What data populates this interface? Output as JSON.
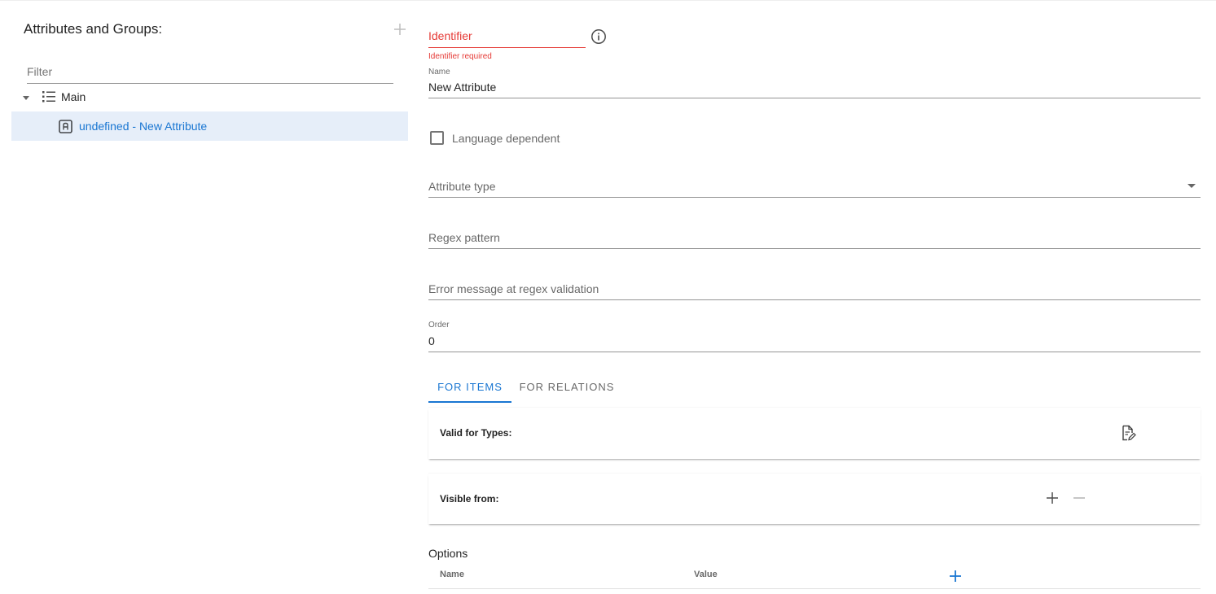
{
  "left_panel": {
    "title": "Attributes and Groups:",
    "filter_placeholder": "Filter",
    "tree": {
      "group_label": "Main",
      "child_label": "undefined - New Attribute"
    }
  },
  "form": {
    "identifier": {
      "label": "Identifier",
      "error": "Identifier required"
    },
    "name": {
      "label": "Name",
      "value": "New Attribute"
    },
    "language_dependent": {
      "label": "Language dependent",
      "checked": false
    },
    "attribute_type": {
      "placeholder": "Attribute type"
    },
    "regex_pattern": {
      "placeholder": "Regex pattern"
    },
    "regex_error": {
      "placeholder": "Error message at regex validation"
    },
    "order": {
      "label": "Order",
      "value": "0"
    }
  },
  "tabs": [
    {
      "label": "FOR ITEMS",
      "active": true
    },
    {
      "label": "FOR RELATIONS",
      "active": false
    }
  ],
  "cards": {
    "valid_for_types": "Valid for Types:",
    "visible_from": "Visible from:"
  },
  "options": {
    "title": "Options",
    "columns": [
      "Name",
      "Value"
    ]
  },
  "colors": {
    "accent": "#1976d2",
    "error": "#e53935",
    "selected_row": "#e6eef9"
  },
  "icons": {
    "add_group": "plus-icon",
    "caret": "caret-down-icon",
    "group": "list-icon",
    "attribute": "attribute-a-icon",
    "info": "info-icon",
    "edit_types": "edit-document-icon",
    "add_visible": "plus-icon",
    "remove_visible": "minus-icon",
    "add_option": "plus-icon"
  }
}
